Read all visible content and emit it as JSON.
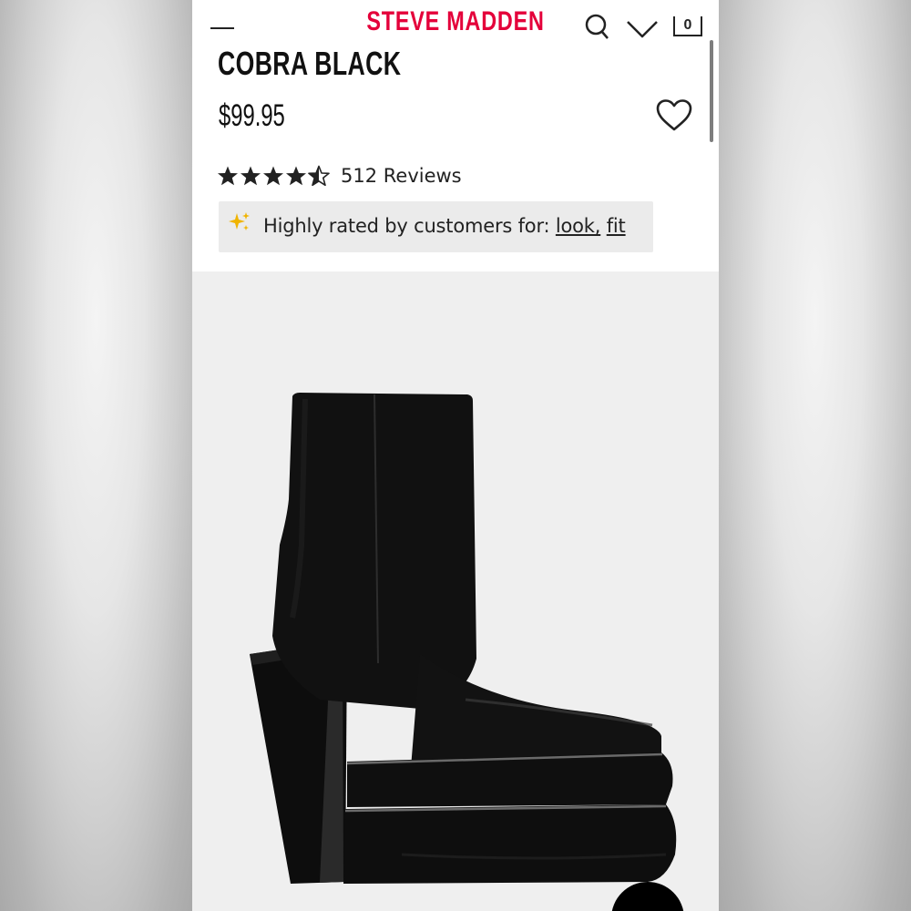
{
  "header": {
    "brand": "STEVE MADDEN",
    "cart_count": "0",
    "icons": [
      "menu-icon",
      "search-icon",
      "heart-icon",
      "bag-icon"
    ]
  },
  "product": {
    "title": "COBRA BLACK",
    "price": "$99.95",
    "rating": 4.5,
    "rating_max": 5,
    "reviews_label": "512 Reviews"
  },
  "highlight": {
    "prefix": "Highly rated by customers for:",
    "tags": [
      "look,",
      "fit"
    ]
  },
  "colors": {
    "brand_red": "#e4003a",
    "text": "#222222",
    "highlight_bg": "#ebebeb",
    "image_bg": "#efefef",
    "sparkle": "#f0b400"
  }
}
